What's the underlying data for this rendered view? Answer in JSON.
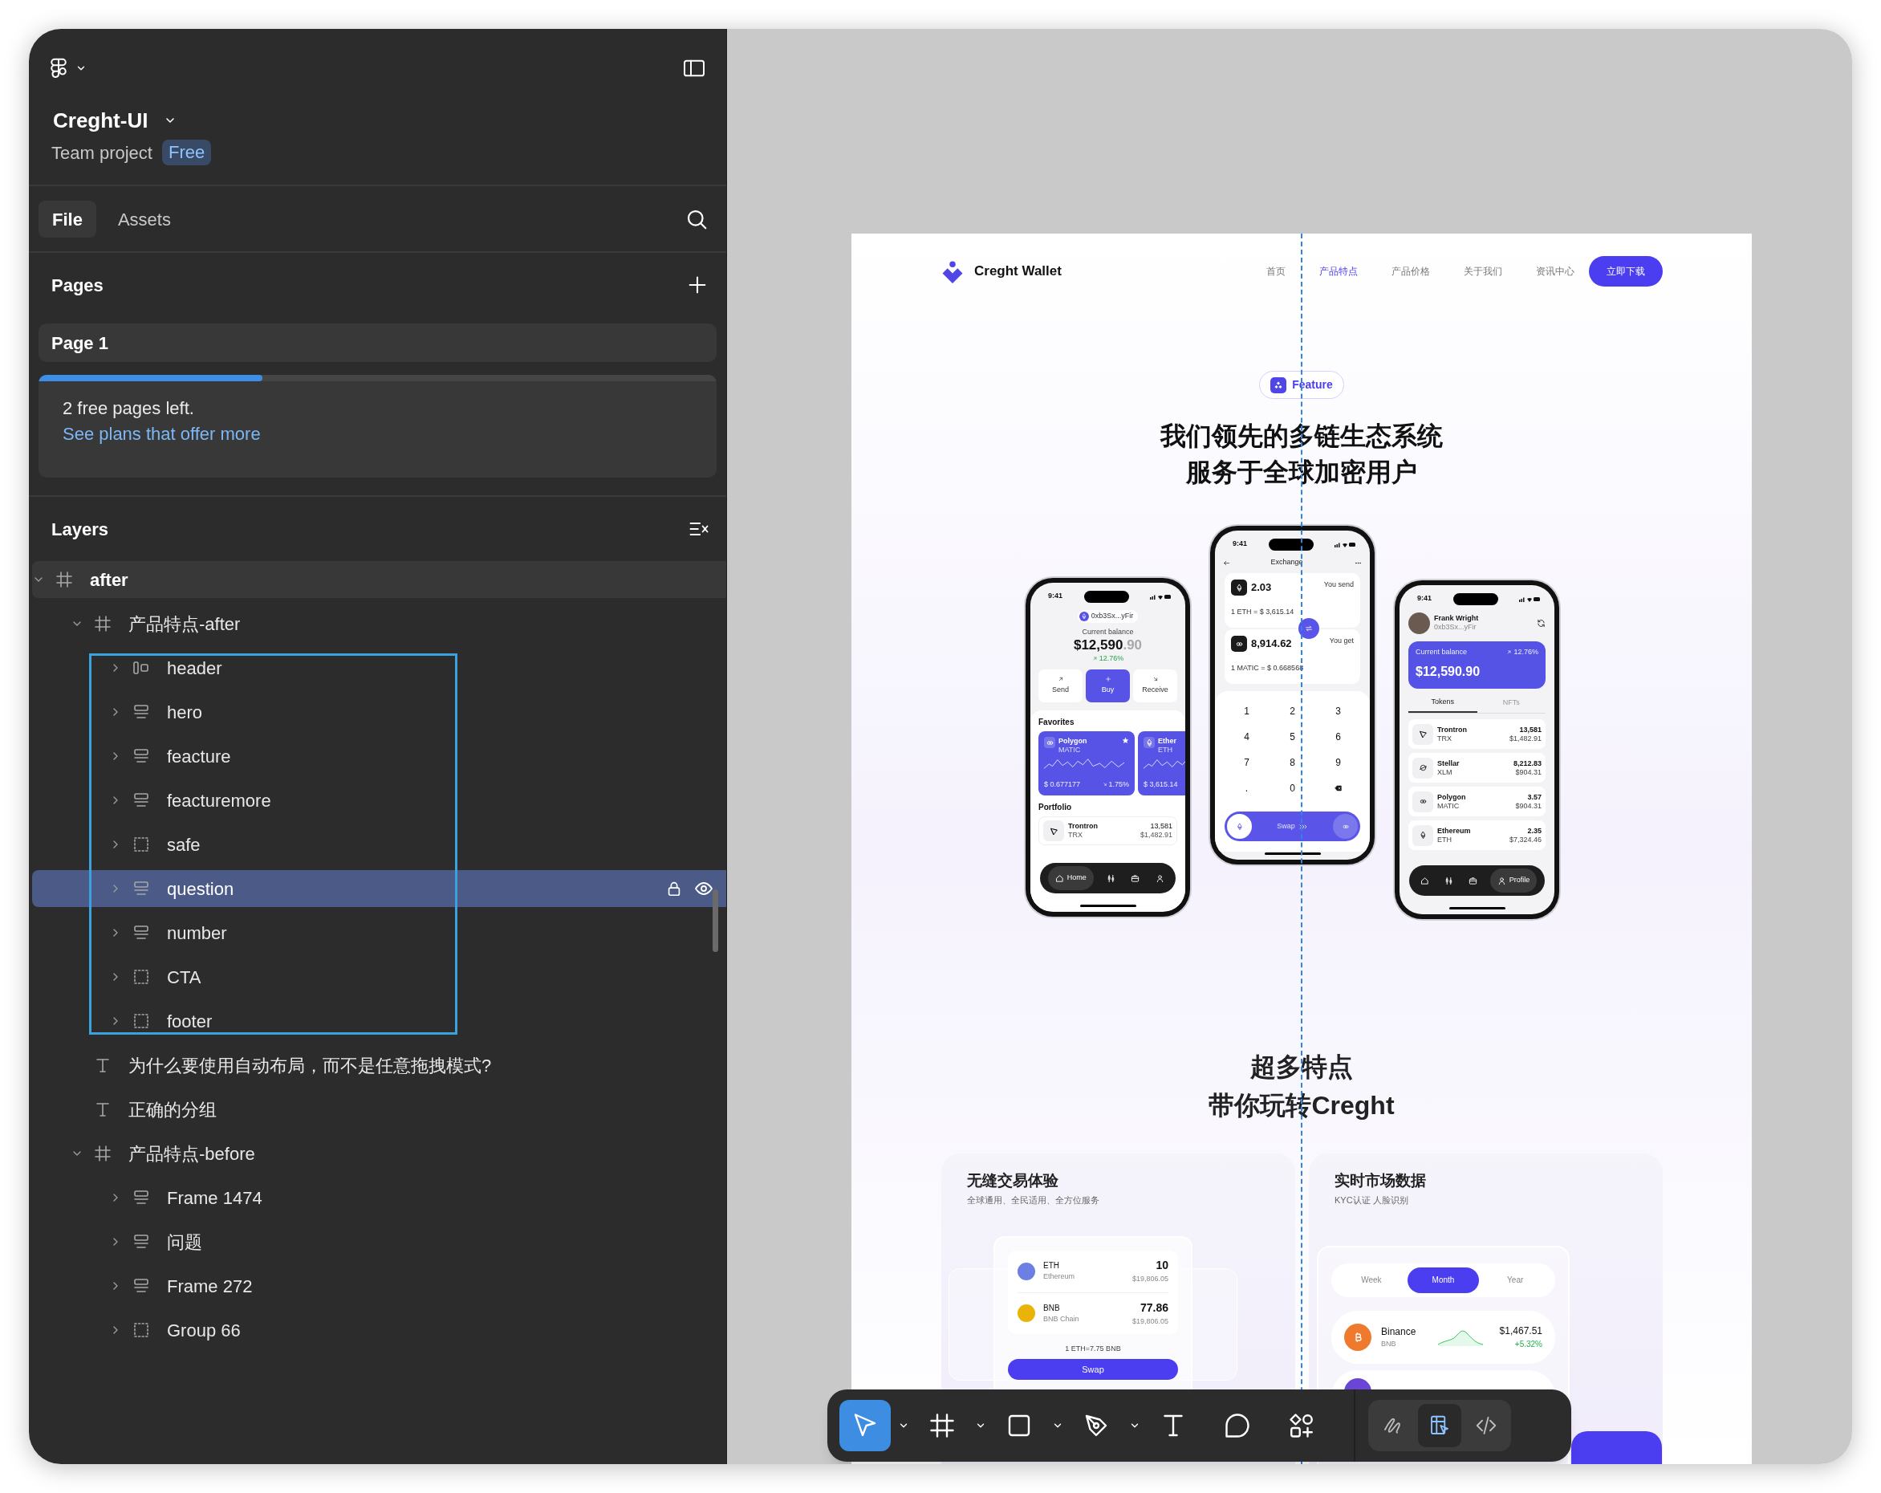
{
  "sidebar": {
    "header": {
      "project": "Creght-UI",
      "team": "Team project",
      "plan": "Free"
    },
    "tabs": [
      {
        "label": "File",
        "selected": true
      },
      {
        "label": "Assets",
        "selected": false
      }
    ],
    "pages": {
      "title": "Pages",
      "items": [
        {
          "label": "Page 1",
          "selected": true
        }
      ]
    },
    "upgrade": {
      "level": 0.33,
      "message": "2 free pages left.",
      "link": "See plans that offer more"
    },
    "layers": {
      "title": "Layers",
      "items": [
        {
          "name": "after",
          "kind": "frame",
          "expanded": true,
          "highlighted": true,
          "selected": false,
          "children": [
            {
              "name": "产品特点-after",
              "kind": "frame",
              "expanded": true,
              "outlined": true,
              "selected": false,
              "children": [
                {
                  "name": "header",
                  "kind": "row",
                  "expanded": false,
                  "selected": false
                },
                {
                  "name": "hero",
                  "kind": "stack",
                  "expanded": false,
                  "selected": false
                },
                {
                  "name": "feacture",
                  "kind": "stack",
                  "expanded": false,
                  "selected": false
                },
                {
                  "name": "feacturemore",
                  "kind": "stack",
                  "expanded": false,
                  "selected": false
                },
                {
                  "name": "safe",
                  "kind": "group",
                  "expanded": false,
                  "selected": false
                },
                {
                  "name": "question",
                  "kind": "stack",
                  "expanded": false,
                  "selected": true
                },
                {
                  "name": "number",
                  "kind": "stack",
                  "expanded": false,
                  "selected": false
                },
                {
                  "name": "CTA",
                  "kind": "group",
                  "expanded": false,
                  "selected": false
                },
                {
                  "name": "footer",
                  "kind": "group",
                  "expanded": false,
                  "selected": false
                }
              ]
            },
            {
              "name": "为什么要使用自动布局，而不是任意拖拽模式?",
              "kind": "text",
              "selected": false
            },
            {
              "name": "正确的分组",
              "kind": "text",
              "selected": false
            },
            {
              "name": "产品特点-before",
              "kind": "frame",
              "expanded": true,
              "selected": false,
              "children": [
                {
                  "name": "Frame 1474",
                  "kind": "stack",
                  "expanded": false,
                  "selected": false
                },
                {
                  "name": "问题",
                  "kind": "stack",
                  "expanded": false,
                  "selected": false
                },
                {
                  "name": "Frame 272",
                  "kind": "stack",
                  "expanded": false,
                  "selected": false
                },
                {
                  "name": "Group 66",
                  "kind": "group",
                  "expanded": false,
                  "selected": false
                }
              ]
            }
          ]
        }
      ]
    }
  },
  "canvas": {
    "design": {
      "nav": {
        "brand": "Creght Wallet",
        "links": [
          {
            "label": "首页",
            "selected": false
          },
          {
            "label": "产品特点",
            "selected": true
          },
          {
            "label": "产品价格",
            "selected": false
          },
          {
            "label": "关于我们",
            "selected": false
          },
          {
            "label": "资讯中心",
            "selected": false
          }
        ],
        "cta": "立即下载"
      },
      "hero": {
        "badge": "Feature",
        "title_lines": [
          "我们领先的多链生态系统",
          "服务于全球加密用户"
        ],
        "phones": [
          {
            "kind": "wallet",
            "time": "9:41",
            "address": "0xb3Sx...yFir",
            "balance_label": "Current balance",
            "balance": "$12,590",
            "balance_cents": ".90",
            "change": "12.76%",
            "actions": [
              {
                "label": "Send",
                "kind": "send",
                "selected": false
              },
              {
                "label": "Buy",
                "kind": "buy",
                "selected": true
              },
              {
                "label": "Receive",
                "kind": "receive",
                "selected": false
              }
            ],
            "favorites_title": "Favorites",
            "favorites": [
              {
                "name": "Polygon",
                "symbol": "MATIC",
                "kind": "polygon",
                "price": "$ 0.677177",
                "change": "1.75%",
                "starred": true
              },
              {
                "name": "Ether",
                "symbol": "ETH",
                "kind": "eth",
                "price": "$ 3,615.14"
              }
            ],
            "portfolio_title": "Portfolio",
            "portfolio": [
              {
                "name": "Trontron",
                "symbol": "TRX",
                "kind": "tron",
                "amount": "13,581",
                "value": "$1,482.91"
              }
            ],
            "nav": [
              {
                "kind": "home",
                "label": "Home",
                "selected": true
              },
              {
                "kind": "chart",
                "selected": false
              },
              {
                "kind": "bag",
                "selected": false
              },
              {
                "kind": "user",
                "selected": false
              }
            ]
          },
          {
            "kind": "exchange",
            "time": "9:41",
            "title": "Exchange",
            "legs": [
              {
                "kind": "eth",
                "amount": "2.03",
                "label": "You send",
                "rate": "1 ETH = $ 3,615.14"
              },
              {
                "kind": "polygon",
                "amount": "8,914.62",
                "label": "You get",
                "rate": "1 MATIC = $ 0.668568"
              }
            ],
            "keys": [
              "1",
              "2",
              "3",
              "4",
              "5",
              "6",
              "7",
              "8",
              "9",
              ".",
              "0"
            ],
            "swap": {
              "label": "Swap",
              "level": 0
            }
          },
          {
            "kind": "profile",
            "time": "9:41",
            "user": "Frank Wright",
            "address": "0xb3Sx...yFir",
            "balance_label": "Current balance",
            "change": "12.76%",
            "balance": "$12,590.90",
            "tabs": [
              {
                "label": "Tokens",
                "selected": true
              },
              {
                "label": "NFTs",
                "selected": false
              }
            ],
            "tokens": [
              {
                "name": "Trontron",
                "symbol": "TRX",
                "kind": "tron",
                "amount": "13,581",
                "value": "$1,482.91"
              },
              {
                "name": "Stellar",
                "symbol": "XLM",
                "kind": "stellar",
                "amount": "8,212.83",
                "value": "$904.31"
              },
              {
                "name": "Polygon",
                "symbol": "MATIC",
                "kind": "polygon",
                "amount": "3.57",
                "value": "$904.31"
              },
              {
                "name": "Ethereum",
                "symbol": "ETH",
                "kind": "eth",
                "amount": "2.35",
                "value": "$7,324.46"
              }
            ],
            "nav": [
              {
                "kind": "home",
                "selected": false
              },
              {
                "kind": "chart",
                "selected": false
              },
              {
                "kind": "bag",
                "selected": false
              },
              {
                "kind": "user",
                "label": "Profile",
                "selected": true
              }
            ]
          }
        ]
      },
      "features": {
        "title_lines": [
          "超多特点",
          "带你玩转Creght"
        ],
        "cards": [
          {
            "kind": "swap",
            "title": "无缝交易体验",
            "subtitle": "全球通用、全民适用、全方位服务",
            "rows": [
              {
                "symbol": "ETH",
                "chain": "Ethereum",
                "amount": "10",
                "value": "$19,806.05",
                "color": "#6c7fe3"
              },
              {
                "symbol": "BNB",
                "chain": "BNB Chain",
                "amount": "77.86",
                "value": "$19,806.05",
                "color": "#eab308"
              }
            ],
            "rate": "1 ETH=7.75 BNB",
            "button": "Swap"
          },
          {
            "kind": "market",
            "title": "实时市场数据",
            "subtitle": "KYC认证 人脸识别",
            "periods": [
              {
                "label": "Week",
                "selected": false
              },
              {
                "label": "Month",
                "selected": true
              },
              {
                "label": "Year",
                "selected": false
              }
            ],
            "coins": [
              {
                "name": "Binance",
                "symbol": "BNB",
                "price": "$1,467.51",
                "change": "+5.32%",
                "color": "#ef7a2d"
              },
              {
                "color": "#6b45d6"
              }
            ]
          }
        ]
      }
    }
  },
  "toolbar": {
    "tools": [
      {
        "kind": "move",
        "selected": true,
        "dropdown": true
      },
      {
        "kind": "frame",
        "selected": false,
        "dropdown": true
      },
      {
        "kind": "rectangle",
        "selected": false,
        "dropdown": true
      },
      {
        "kind": "pen",
        "selected": false,
        "dropdown": true
      },
      {
        "kind": "text",
        "selected": false,
        "dropdown": false
      },
      {
        "kind": "comment",
        "selected": false,
        "dropdown": false
      },
      {
        "kind": "shapes",
        "selected": false,
        "dropdown": false
      }
    ],
    "modes": [
      {
        "kind": "draw",
        "selected": false
      },
      {
        "kind": "design",
        "selected": true
      },
      {
        "kind": "code",
        "selected": false
      }
    ]
  }
}
